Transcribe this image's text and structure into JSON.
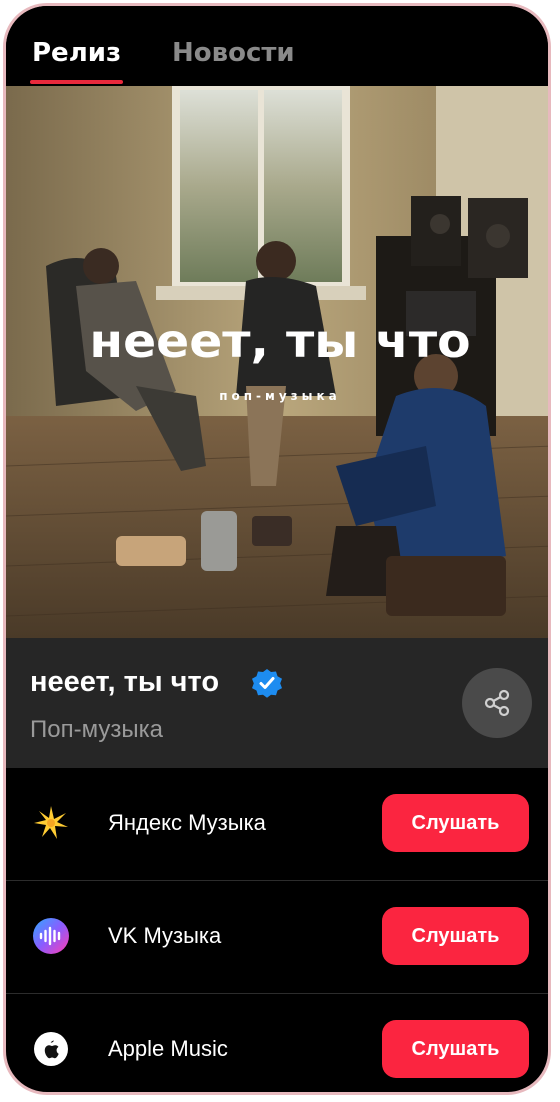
{
  "tabs": [
    {
      "label": "Релиз",
      "active": true
    },
    {
      "label": "Новости",
      "active": false
    }
  ],
  "cover": {
    "title": "нееет, ты что",
    "genre": "поп-музыка"
  },
  "release": {
    "title": "нееет, ты что",
    "genre": "Поп-музыка",
    "verified": true,
    "share_icon": "share-icon"
  },
  "services": [
    {
      "name": "Яндекс Музыка",
      "icon": "yandex-music-icon",
      "button": "Слушать"
    },
    {
      "name": "VK Музыка",
      "icon": "vk-music-icon",
      "button": "Слушать"
    },
    {
      "name": "Apple Music",
      "icon": "apple-music-icon",
      "button": "Слушать"
    }
  ],
  "colors": {
    "accent": "#fb2540",
    "tab_underline": "#e8293c",
    "verified": "#1d8cf0",
    "panel": "#262626"
  }
}
